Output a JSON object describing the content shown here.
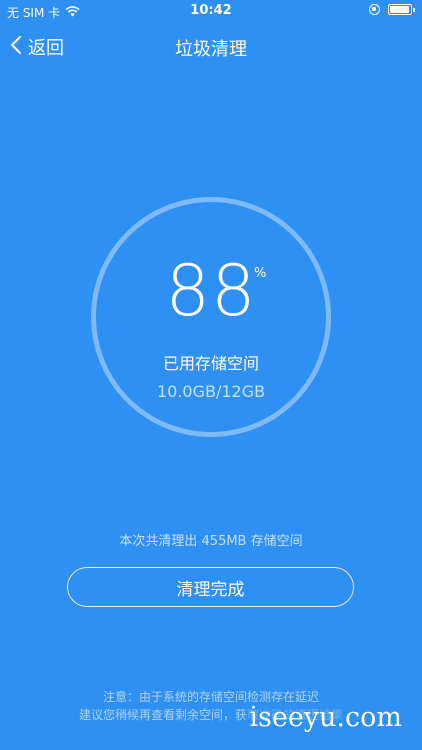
{
  "status_bar": {
    "carrier": "无 SIM 卡",
    "time": "10:42",
    "battery_level": 0.95,
    "icons": [
      "wifi-icon",
      "rotation-lock-icon",
      "battery-icon"
    ]
  },
  "nav": {
    "back_label": "返回",
    "title": "垃圾清理",
    "back_icon": "chevron-left-icon"
  },
  "storage": {
    "percent": "88",
    "percent_unit": "%",
    "label": "已用存储空间",
    "capacity": "10.0GB/12GB",
    "ring_color": "#ffffff"
  },
  "result": {
    "summary": "本次共清理出 455MB 存储空间",
    "done_label": "清理完成"
  },
  "notice": {
    "line1": "注意：由于系统的存储空间检测存在延迟",
    "line2": "建议您稍候再查看剩余空间，获取准确的清理结果"
  },
  "watermark": "iseeyu.com",
  "colors": {
    "background": "#2f90f4",
    "text": "#ffffff"
  }
}
